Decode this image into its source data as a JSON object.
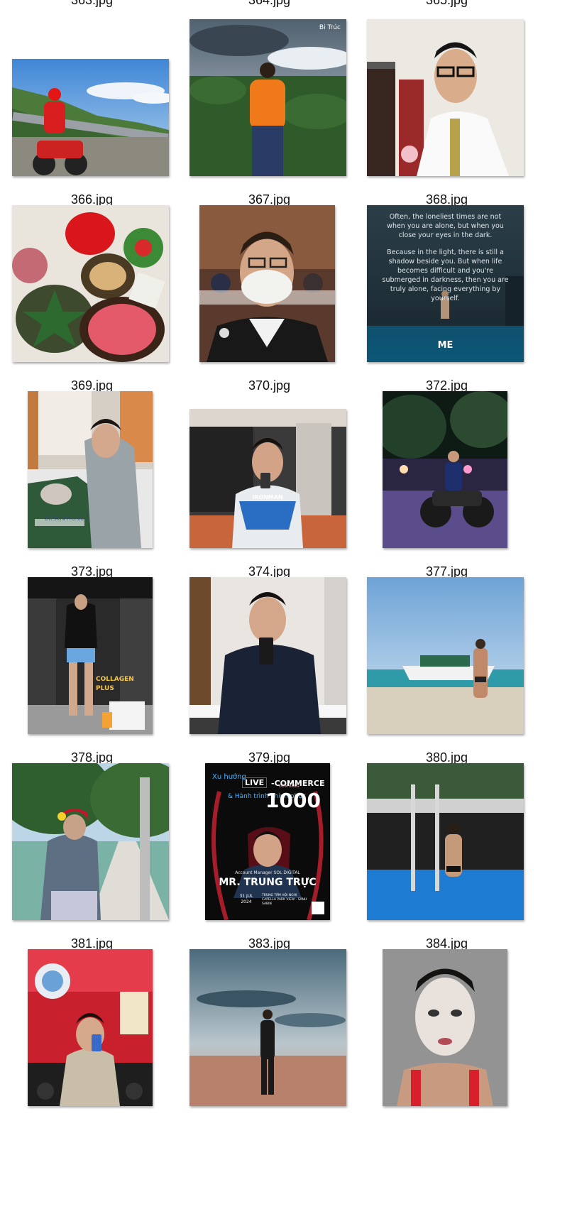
{
  "partial_row": [
    "363.jpg",
    "364.jpg",
    "365.jpg"
  ],
  "rows": [
    [
      "366.jpg",
      "367.jpg",
      "368.jpg"
    ],
    [
      "369.jpg",
      "370.jpg",
      "372.jpg"
    ],
    [
      "373.jpg",
      "374.jpg",
      "377.jpg"
    ],
    [
      "378.jpg",
      "379.jpg",
      "380.jpg"
    ],
    [
      "381.jpg",
      "383.jpg",
      "384.jpg"
    ]
  ],
  "thumbs": {
    "367": {
      "watermark": "Bi Trúc"
    },
    "372": {
      "quote_1": "Often, the loneliest times are not when you are alone, but when you close your eyes in the dark.",
      "quote_2": "Because in the light, there is still a shadow beside you. But when life becomes difficult and you're submerged in darkness, then you are truly alone, facing everything by yourself.",
      "title": "ME"
    },
    "373": {
      "shirt_text": "DR.SKIN Premium"
    },
    "374": {
      "brand_text": "IRONMAN"
    },
    "378": {
      "promo_text": "COLLAGEN PLUS"
    },
    "383": {
      "line_a": "Xu hướng",
      "live_badge": "LIVE",
      "commerce": "-COMMERCE",
      "line_b": "& Hành trình chinh phục",
      "big_number": "1000",
      "small_number": "ĐƠN HÀNG",
      "role": "Account Manager SOL DIGITAL",
      "name": "MR. TRUNG TRỰC",
      "date": "31 JUL 2024",
      "venue": "TRUNG TÂM HỘI NGHỊ CAPELLA PARK VIEW - SẢNH SABIN"
    }
  }
}
